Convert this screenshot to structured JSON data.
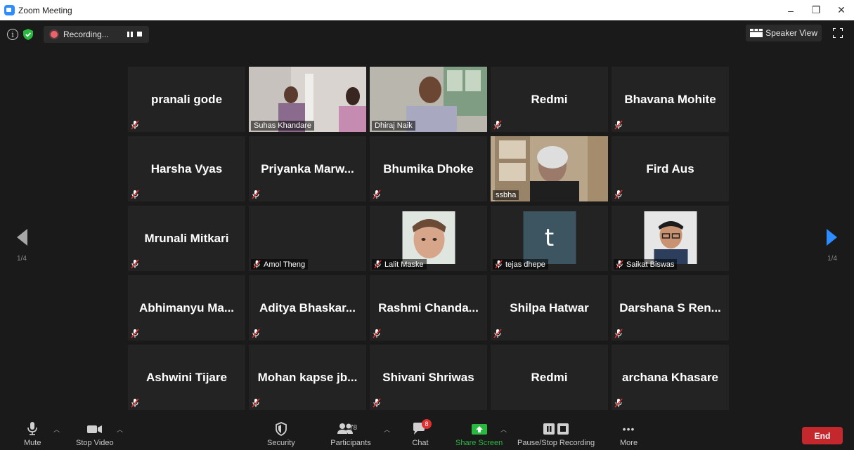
{
  "window": {
    "title": "Zoom Meeting",
    "minimize": "–",
    "restore": "❐",
    "close": "✕"
  },
  "topbar": {
    "info_icon": "info-icon",
    "security_badge": "shield-check-icon",
    "recording_label": "Recording...",
    "speaker_view_label": "Speaker View"
  },
  "colors": {
    "accent": "#2d8cff",
    "active_speaker": "#d6e34a",
    "end": "#c5282c",
    "share": "#2ab940",
    "badge": "#e0302f"
  },
  "pagination": {
    "current_left": "1/4",
    "current_right": "1/4"
  },
  "participants": [
    {
      "name": "pranali gode",
      "type": "name",
      "muted": true
    },
    {
      "name": "Suhas Khandare",
      "type": "video",
      "muted": false,
      "active": true
    },
    {
      "name": "Dhiraj Naik",
      "type": "video",
      "muted": false
    },
    {
      "name": "Redmi",
      "type": "name",
      "muted": true
    },
    {
      "name": "Bhavana Mohite",
      "type": "name",
      "muted": true
    },
    {
      "name": "Harsha Vyas",
      "type": "name",
      "muted": true
    },
    {
      "name": "Priyanka  Marw...",
      "type": "name",
      "muted": true
    },
    {
      "name": "Bhumika Dhoke",
      "type": "name",
      "muted": true
    },
    {
      "name": "ssbha",
      "type": "video",
      "muted": false
    },
    {
      "name": "Fird Aus",
      "type": "name",
      "muted": true
    },
    {
      "name": "Mrunali Mitkari",
      "type": "name",
      "muted": true
    },
    {
      "name": "Amol Theng",
      "type": "tag",
      "muted": true
    },
    {
      "name": "Lalit Maske",
      "type": "photo",
      "muted": true
    },
    {
      "name": "tejas dhepe",
      "type": "letter",
      "letter": "t",
      "muted": true
    },
    {
      "name": "Saikat Biswas",
      "type": "photo",
      "muted": true
    },
    {
      "name": "Abhimanyu  Ma...",
      "type": "name",
      "muted": true
    },
    {
      "name": "Aditya  Bhaskar...",
      "type": "name",
      "muted": true
    },
    {
      "name": "Rashmi  Chanda...",
      "type": "name",
      "muted": true
    },
    {
      "name": "Shilpa Hatwar",
      "type": "name",
      "muted": true
    },
    {
      "name": "Darshana  S  Ren...",
      "type": "name",
      "muted": true
    },
    {
      "name": "Ashwini Tijare",
      "type": "name",
      "muted": true
    },
    {
      "name": "Mohan  kapse  jb...",
      "type": "name",
      "muted": true
    },
    {
      "name": "Shivani Shriwas",
      "type": "name",
      "muted": true
    },
    {
      "name": "Redmi",
      "type": "name",
      "muted": false
    },
    {
      "name": "archana Khasare",
      "type": "name",
      "muted": true
    }
  ],
  "toolbar": {
    "mute": "Mute",
    "stop_video": "Stop Video",
    "security": "Security",
    "participants": "Participants",
    "participants_count": "78",
    "chat": "Chat",
    "chat_badge": "8",
    "share_screen": "Share Screen",
    "pause_stop_recording": "Pause/Stop Recording",
    "more": "More",
    "more_icon": "•••",
    "end": "End"
  }
}
